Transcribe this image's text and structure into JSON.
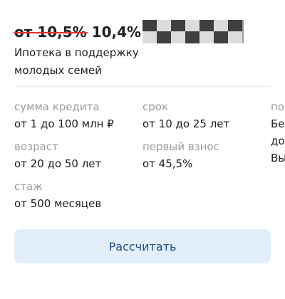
{
  "offer": {
    "old_rate": "от 10,5%",
    "new_rate": "10,4%",
    "title": "Ипотека в поддержку молодых семей",
    "logo_icon": "bank-logo-checker-icon"
  },
  "params": {
    "sum_label": "сумма кредита",
    "sum_value": "от 1 до 100 млн ₽",
    "term_label": "срок",
    "term_value": "от 10 до 25 лет",
    "age_label": "возраст",
    "age_value": "от 20 до 50 лет",
    "down_label": "первый взнос",
    "down_value": "от 45,5%",
    "exp_label": "стаж",
    "exp_value": "от 500 месяцев",
    "cut_label": "по",
    "cut_line1": "Бе",
    "cut_line2": "до",
    "cut_line3": "Вы"
  },
  "actions": {
    "calculate_label": "Рассчитать"
  },
  "colors": {
    "strike": "#e03131",
    "button_bg": "#e2effb",
    "button_text": "#1f4a8d",
    "label_gray": "#9e9b98"
  }
}
